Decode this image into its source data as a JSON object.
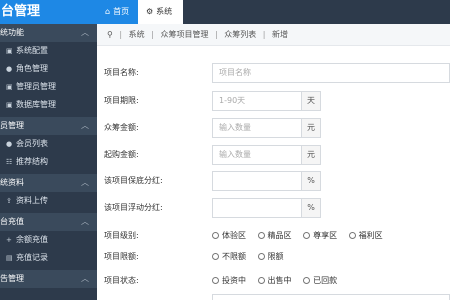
{
  "app": {
    "brand": "台管理"
  },
  "top_tabs": [
    {
      "label": "首页",
      "icon": "home-icon"
    },
    {
      "label": "系统",
      "icon": "gear-icon"
    }
  ],
  "sidebar": [
    {
      "type": "group",
      "label": "统功能"
    },
    {
      "type": "item",
      "label": "系统配置"
    },
    {
      "type": "item",
      "label": "角色管理"
    },
    {
      "type": "item",
      "label": "管理员管理"
    },
    {
      "type": "item",
      "label": "数据库管理"
    },
    {
      "type": "group",
      "label": "员管理"
    },
    {
      "type": "item",
      "label": "会员列表"
    },
    {
      "type": "item",
      "label": "推荐结构"
    },
    {
      "type": "group",
      "label": "统资料"
    },
    {
      "type": "item",
      "label": "资料上传"
    },
    {
      "type": "group",
      "label": "台充值"
    },
    {
      "type": "item",
      "label": "余额充值"
    },
    {
      "type": "item",
      "label": "充值记录"
    },
    {
      "type": "group",
      "label": "告管理"
    }
  ],
  "breadcrumb": [
    "系统",
    "众筹项目管理",
    "众筹列表",
    "新增"
  ],
  "form": {
    "name": {
      "label": "项目名称:",
      "placeholder": "项目名称"
    },
    "period": {
      "label": "项目期限:",
      "placeholder": "1-90天",
      "addon": "天"
    },
    "amount": {
      "label": "众筹金额:",
      "placeholder": "输入数量",
      "addon": "元"
    },
    "min_amount": {
      "label": "起购金额:",
      "placeholder": "输入数量",
      "addon": "元"
    },
    "guarantee": {
      "label": "该项目保底分红:",
      "addon": "%"
    },
    "float_share": {
      "label": "该项目浮动分红:",
      "addon": "%"
    },
    "category": {
      "label": "项目级别:",
      "options": [
        "体验区",
        "精品区",
        "尊享区",
        "福利区"
      ]
    },
    "limit": {
      "label": "项目限额:",
      "options": [
        "不限额",
        "限额"
      ]
    },
    "status": {
      "label": "项目状态:",
      "options": [
        "投资中",
        "出售中",
        "已回款"
      ]
    }
  }
}
